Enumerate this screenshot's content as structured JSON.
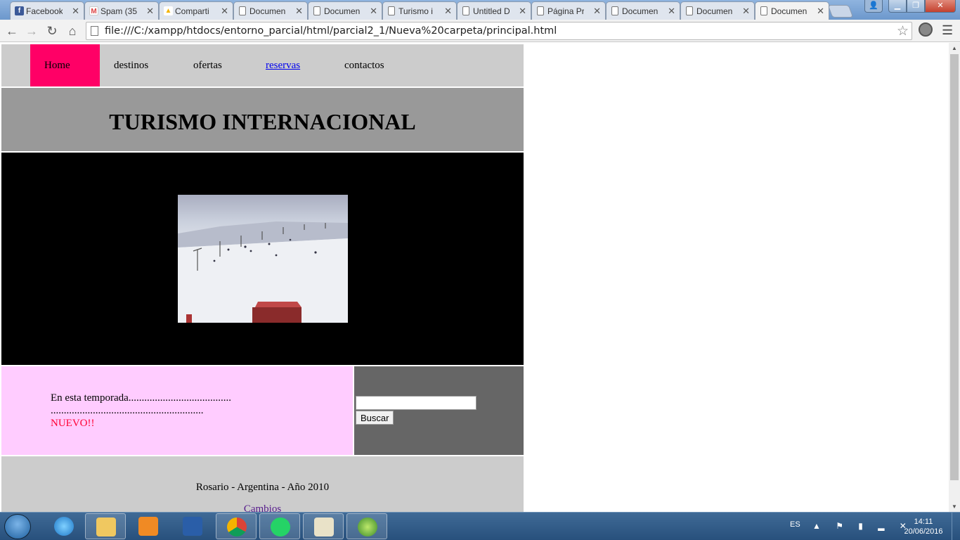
{
  "browser": {
    "tabs": [
      {
        "label": "Facebook",
        "icon": "facebook-icon"
      },
      {
        "label": "Spam (35",
        "icon": "gmail-icon"
      },
      {
        "label": "Comparti",
        "icon": "drive-icon"
      },
      {
        "label": "Documen",
        "icon": "document-icon"
      },
      {
        "label": "Documen",
        "icon": "document-icon"
      },
      {
        "label": "Turismo i",
        "icon": "document-icon"
      },
      {
        "label": "Untitled D",
        "icon": "document-icon"
      },
      {
        "label": "Página Pr",
        "icon": "document-icon"
      },
      {
        "label": "Documen",
        "icon": "document-icon"
      },
      {
        "label": "Documen",
        "icon": "document-icon"
      },
      {
        "label": "Documen",
        "icon": "document-icon"
      }
    ],
    "active_tab_index": 10,
    "url": "file:///C:/xampp/htdocs/entorno_parcial/html/parcial2_1/Nueva%20carpeta/principal.html"
  },
  "site": {
    "nav": {
      "home": "Home",
      "destinos": "destinos",
      "ofertas": "ofertas",
      "reservas": "reservas",
      "contactos": "contactos"
    },
    "title": "TURISMO INTERNACIONAL",
    "promo": {
      "line1": "En esta temporada.......................................",
      "line2": "..........................................................",
      "new_label": "NUEVO!!"
    },
    "search": {
      "value": "",
      "button": "Buscar"
    },
    "footer": {
      "text": "Rosario - Argentina - Año 2010",
      "link": "Cambios"
    },
    "colors": {
      "nav_bg": "#cccccc",
      "home_bg": "#ff0066",
      "header_bg": "#999999",
      "promo_bg": "#ffccff",
      "search_bg": "#666666",
      "new_text": "#ff0033"
    }
  },
  "taskbar": {
    "language": "ES",
    "time": "14:11",
    "date": "20/06/2016"
  }
}
